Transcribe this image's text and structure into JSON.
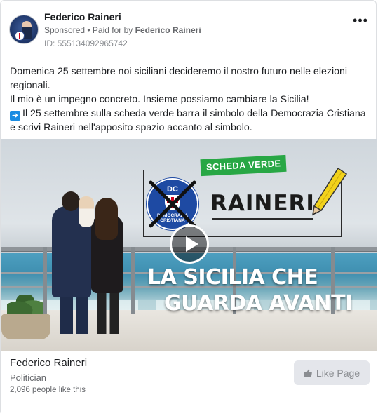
{
  "header": {
    "page_name": "Federico Raineri",
    "sponsored_label": "Sponsored",
    "paid_for_prefix": " • Paid for by ",
    "paid_for_name": "Federico Raineri",
    "ad_id": "ID: 555134092965742",
    "more_icon": "more-dots-icon"
  },
  "post": {
    "line1": "Domenica 25 settembre noi siciliani decideremo il nostro futuro nelle elezioni regionali.",
    "line2": "Il mio è un impegno concreto. Insieme possiamo cambiare la Sicilia!",
    "arrow_icon": "right-arrow-icon",
    "line3": "Il 25 settembre sulla scheda verde barra il simbolo della Democrazia Cristiana e scrivi Raineri nell'apposito spazio accanto al simbolo."
  },
  "media": {
    "badge": "SCHEDA VERDE",
    "logo_letters": "DC",
    "logo_ring_text": "DEMOCRAZIA CRISTIANA",
    "candidate": "RAINERI",
    "headline_line1": "LA SICILIA CHE",
    "headline_line2": "GUARDA AVANTI",
    "play_icon": "play-icon",
    "colors": {
      "badge": "#28a745",
      "logo": "#1e4aa3",
      "pencil": "#f2d21b"
    }
  },
  "footer": {
    "page_name": "Federico Raineri",
    "category": "Politician",
    "likes": "2,096 people like this",
    "like_button_label": "Like Page",
    "like_icon": "thumbs-up-icon"
  }
}
